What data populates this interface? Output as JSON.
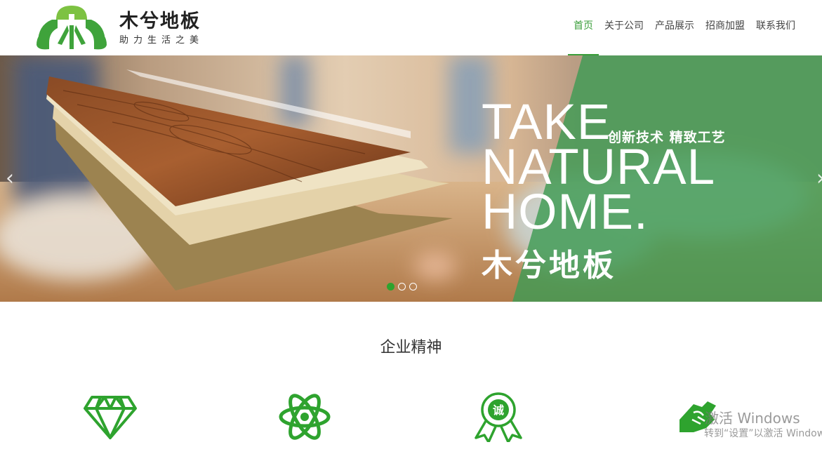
{
  "brand": {
    "name": "木兮地板",
    "slogan": "助力生活之美",
    "logo_glyph": "木",
    "colors": {
      "accent": "#3a9e3a",
      "logo_green": "#3fa33b",
      "logo_light": "#7dc242"
    }
  },
  "nav": {
    "items": [
      {
        "label": "首页",
        "active": true
      },
      {
        "label": "关于公司",
        "active": false
      },
      {
        "label": "产品展示",
        "active": false
      },
      {
        "label": "招商加盟",
        "active": false
      },
      {
        "label": "联系我们",
        "active": false
      }
    ]
  },
  "banner": {
    "line1": "TAKE",
    "tagline": "创新技术 精致工艺",
    "line2": "NATURAL",
    "line3": "HOME.",
    "brand_text": "木兮地板",
    "prev_arrow": "‹",
    "next_arrow": "›",
    "slides": {
      "count": 3,
      "active_index": 0
    }
  },
  "spirit": {
    "title": "企业精神",
    "icons": [
      "diamond-icon",
      "atom-icon",
      "integrity-badge-icon",
      "handshake-icon"
    ],
    "badge_text": "诚"
  },
  "watermark": {
    "line1": "激活 Windows",
    "line2": "转到“设置”以激活 Windows"
  }
}
